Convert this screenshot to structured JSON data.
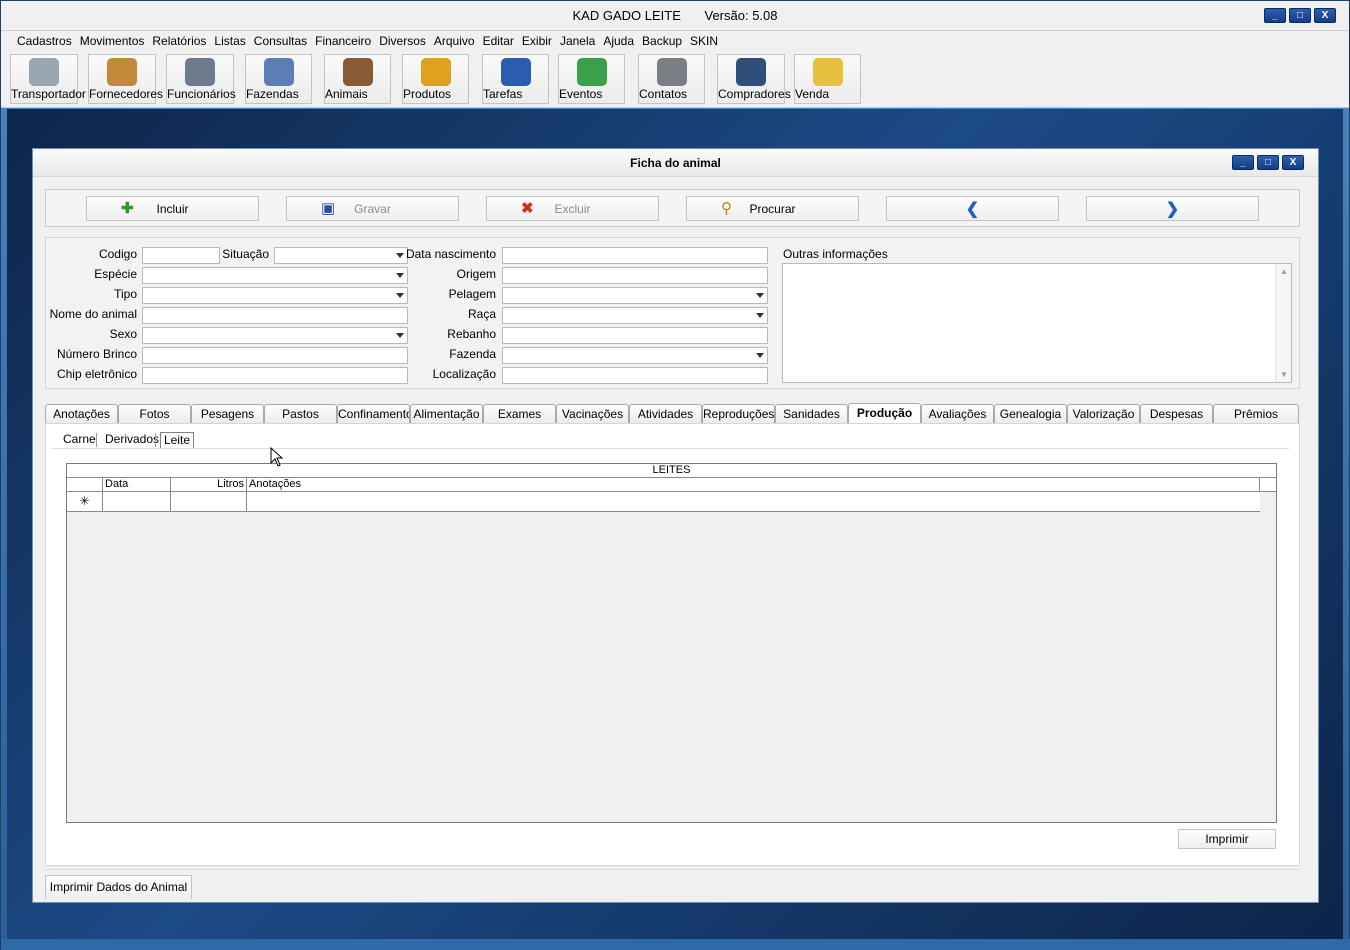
{
  "app": {
    "title": "KAD GADO LEITE",
    "version": "Versão: 5.08",
    "window_buttons": [
      "_",
      "□",
      "X"
    ]
  },
  "menu": [
    "Cadastros",
    "Movimentos",
    "Relatórios",
    "Listas",
    "Consultas",
    "Financeiro",
    "Diversos",
    "Arquivo",
    "Editar",
    "Exibir",
    "Janela",
    "Ajuda",
    "Backup",
    "SKIN"
  ],
  "toolbar": [
    {
      "label": "Transportador",
      "icon": "truck-icon",
      "color": "#9aa6b2"
    },
    {
      "label": "Fornecedores",
      "icon": "suppliers-icon",
      "color": "#c08a3a"
    },
    {
      "label": "Funcionários",
      "icon": "employee-icon",
      "color": "#6d7c8c"
    },
    {
      "label": "Fazendas",
      "icon": "farmhouse-icon",
      "color": "#5b7fb5"
    },
    {
      "label": "Animais",
      "icon": "cow-icon",
      "color": "#8a5a34"
    },
    {
      "label": "Produtos",
      "icon": "box-icon",
      "color": "#e0a020"
    },
    {
      "label": "Tarefas",
      "icon": "screwdriver-icon",
      "color": "#2a5db0"
    },
    {
      "label": "Eventos",
      "icon": "calendar-icon",
      "color": "#3aa04a"
    },
    {
      "label": "Contatos",
      "icon": "address-book-icon",
      "color": "#7a7f85"
    },
    {
      "label": "Compradores",
      "icon": "buyer-icon",
      "color": "#2d4f7a"
    },
    {
      "label": "Venda",
      "icon": "note-pencil-icon",
      "color": "#e8c040"
    }
  ],
  "form": {
    "title": "Ficha do animal",
    "actions": {
      "incluir": "Incluir",
      "gravar": "Gravar",
      "excluir": "Excluir",
      "procurar": "Procurar"
    },
    "labels": {
      "codigo": "Codigo",
      "situacao": "Situação",
      "especie": "Espécie",
      "tipo": "Tipo",
      "nome": "Nome do animal",
      "sexo": "Sexo",
      "brinco": "Número Brinco",
      "chip": "Chip eletrônico",
      "data_nascimento": "Data nascimento",
      "origem": "Origem",
      "pelagem": "Pelagem",
      "raca": "Raça",
      "rebanho": "Rebanho",
      "fazenda": "Fazenda",
      "localizacao": "Localização",
      "outras": "Outras informações"
    },
    "tabs": [
      "Anotações",
      "Fotos",
      "Pesagens",
      "Pastos",
      "Confinamentos",
      "Alimentação",
      "Exames",
      "Vacinações",
      "Atividades",
      "Reproduções",
      "Sanidades",
      "Produção",
      "Avaliações",
      "Genealogia",
      "Valorização",
      "Despesas",
      "Prêmios"
    ],
    "active_tab": "Produção",
    "subtabs": [
      "Carne",
      "Derivados",
      "Leite"
    ],
    "active_subtab": "Leite",
    "grid": {
      "caption": "LEITES",
      "columns": [
        "Data",
        "Litros",
        "Anotações"
      ],
      "new_row_marker": "✳"
    },
    "imprimir": "Imprimir",
    "imprimir_dados": "Imprimir Dados do Animal"
  }
}
